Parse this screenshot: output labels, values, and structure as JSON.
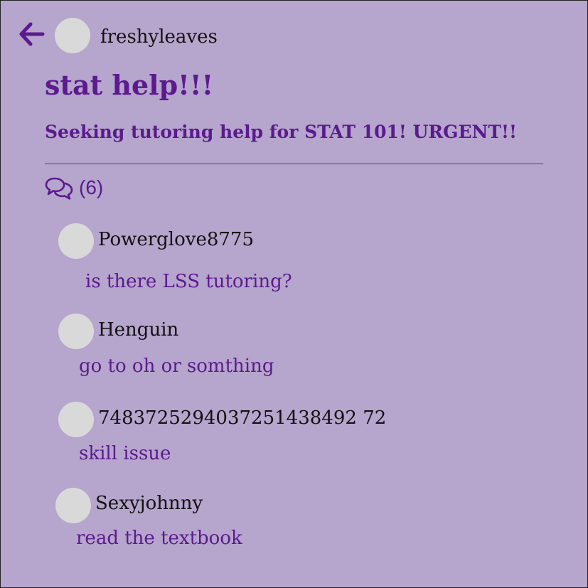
{
  "header": {
    "username": "freshyleaves"
  },
  "post": {
    "title": "stat help!!!",
    "body": "Seeking tutoring help for STAT 101! URGENT!!"
  },
  "comments_summary": {
    "count_label": "(6)"
  },
  "comments": [
    {
      "username": "Powerglove8775",
      "text": "is there LSS tutoring?"
    },
    {
      "username": "Henguin",
      "text": "go to oh or somthing"
    },
    {
      "username": "7483725294037251438492 72",
      "text": "skill issue"
    },
    {
      "username": "Sexyjohnny",
      "text": "read the textbook"
    }
  ],
  "colors": {
    "background": "#b6a5cc",
    "accent": "#5b1a8e",
    "avatar": "#d9d9d9"
  },
  "icons": {
    "back": "arrow-left-icon",
    "comments": "speech-bubbles-icon"
  }
}
